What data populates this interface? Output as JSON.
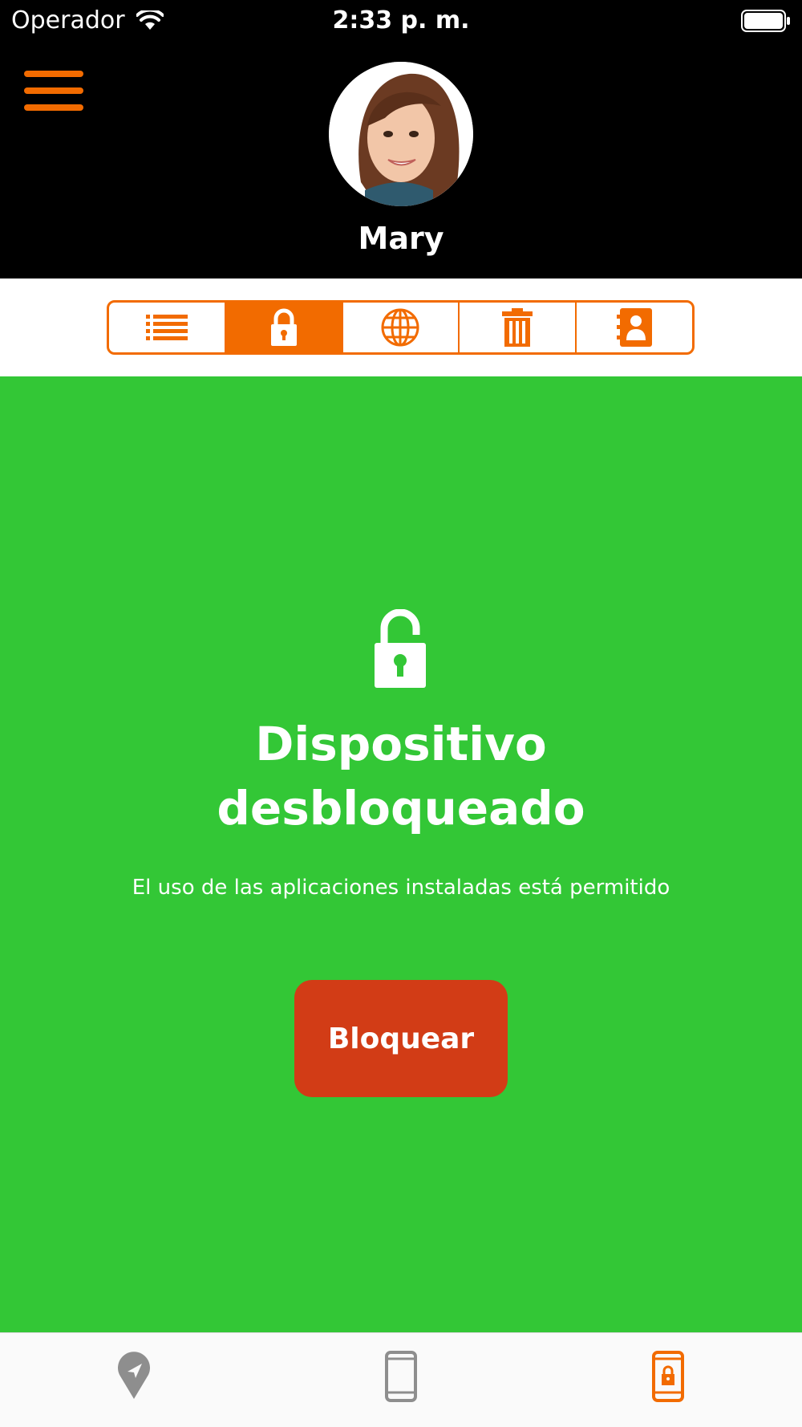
{
  "status_bar": {
    "carrier": "Operador",
    "time": "2:33 p. m."
  },
  "header": {
    "menu_icon": "hamburger-menu-icon",
    "profile_name": "Mary"
  },
  "segments": [
    {
      "icon": "list-icon",
      "active": false
    },
    {
      "icon": "lock-icon",
      "active": true
    },
    {
      "icon": "globe-icon",
      "active": false
    },
    {
      "icon": "trash-icon",
      "active": false
    },
    {
      "icon": "contacts-icon",
      "active": false
    }
  ],
  "main": {
    "status_icon": "unlocked-padlock-icon",
    "title": "Dispositivo desbloqueado",
    "description": "El uso de las aplicaciones instaladas está permitido",
    "button_label": "Bloquear",
    "background_color": "#33c736",
    "button_color": "#d23c16"
  },
  "tabbar": [
    {
      "icon": "location-pin-icon",
      "active": false
    },
    {
      "icon": "phone-icon",
      "active": false
    },
    {
      "icon": "phone-lock-icon",
      "active": true
    }
  ],
  "colors": {
    "accent": "#f26b00",
    "inactive": "#8e8e8e"
  }
}
